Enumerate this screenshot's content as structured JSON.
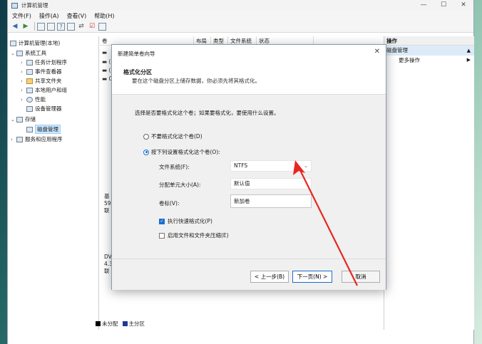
{
  "window": {
    "title": "计算机管理",
    "controls": [
      "—",
      "☐",
      "✕"
    ]
  },
  "menu": [
    "文件(F)",
    "操作(A)",
    "查看(V)",
    "帮助(H)"
  ],
  "tree": {
    "root": "计算机管理(本地)",
    "system_tools": "系统工具",
    "task_scheduler": "任务计划程序",
    "event_viewer": "事件查看器",
    "shared_folders": "共享文件夹",
    "local_users": "本地用户和组",
    "performance": "性能",
    "device_manager": "设备管理器",
    "storage": "存储",
    "disk_management": "磁盘管理",
    "services_apps": "服务和应用程序"
  },
  "columns": [
    "卷",
    "布局",
    "类型",
    "文件系统",
    "状态"
  ],
  "disk_stubs": {
    "a1": "基",
    "a2": "59",
    "a3": "联",
    "b1": "DV",
    "b2": "4.3",
    "b3": "联"
  },
  "legend": {
    "unallocated": "未分配",
    "primary": "主分区"
  },
  "actions": {
    "header": "操作",
    "section": "磁盘管理",
    "more": "更多操作"
  },
  "dialog": {
    "title": "新建简单卷向导",
    "heading": "格式化分区",
    "description": "要在这个磁盘分区上储存数据，你必须先将其格式化。",
    "prompt": "选择是否要格式化这个卷；如果要格式化，要使用什么设置。",
    "option_no_format": "不要格式化这个卷(D)",
    "option_format": "按下列设置格式化这个卷(O):",
    "fs_label": "文件系统(F):",
    "fs_value": "NTFS",
    "alloc_label": "分配单元大小(A):",
    "alloc_value": "默认值",
    "vol_label": "卷标(V):",
    "vol_value": "新加卷",
    "quick_format": "执行快速格式化(P)",
    "compression": "启用文件和文件夹压缩(E)",
    "back": "< 上一步(B)",
    "next": "下一页(N) >",
    "cancel": "取消"
  },
  "colors": {
    "accent": "#1a6fd1",
    "annotation_arrow": "#e8261f",
    "unallocated": "#000000",
    "primary_partition": "#1f3a93"
  }
}
